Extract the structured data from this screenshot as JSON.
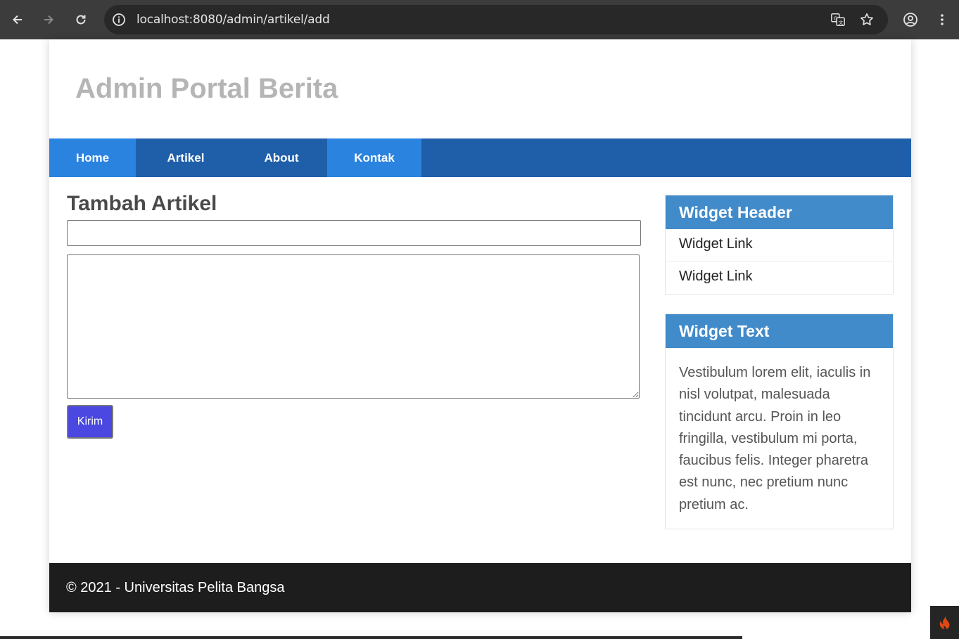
{
  "browser": {
    "url": "localhost:8080/admin/artikel/add"
  },
  "site": {
    "title": "Admin Portal Berita"
  },
  "nav": {
    "items": [
      {
        "label": "Home",
        "active": true
      },
      {
        "label": "Artikel",
        "active": false
      },
      {
        "label": "About",
        "active": false
      },
      {
        "label": "Kontak",
        "active": true
      }
    ]
  },
  "form": {
    "heading": "Tambah Artikel",
    "title_value": "",
    "content_value": "",
    "submit_label": "Kirim"
  },
  "sidebar": {
    "widget1": {
      "header": "Widget Header",
      "links": [
        "Widget Link",
        "Widget Link"
      ]
    },
    "widget2": {
      "header": "Widget Text",
      "text": "Vestibulum lorem elit, iaculis in nisl volutpat, malesuada tincidunt arcu. Proin in leo fringilla, vestibulum mi porta, faucibus felis. Integer pharetra est nunc, nec pretium nunc pretium ac."
    }
  },
  "footer": {
    "text": "© 2021 - Universitas Pelita Bangsa"
  },
  "colors": {
    "navbar": "#1f5faa",
    "nav_active": "#2b83e0",
    "widget_header": "#428bca",
    "footer": "#1d1d1d",
    "submit_button": "#4a48e0"
  },
  "icons": [
    "back-arrow-icon",
    "forward-arrow-icon",
    "reload-icon",
    "site-info-icon",
    "translate-icon",
    "bookmark-star-icon",
    "profile-icon",
    "menu-dots-icon",
    "codeigniter-flame-icon"
  ]
}
